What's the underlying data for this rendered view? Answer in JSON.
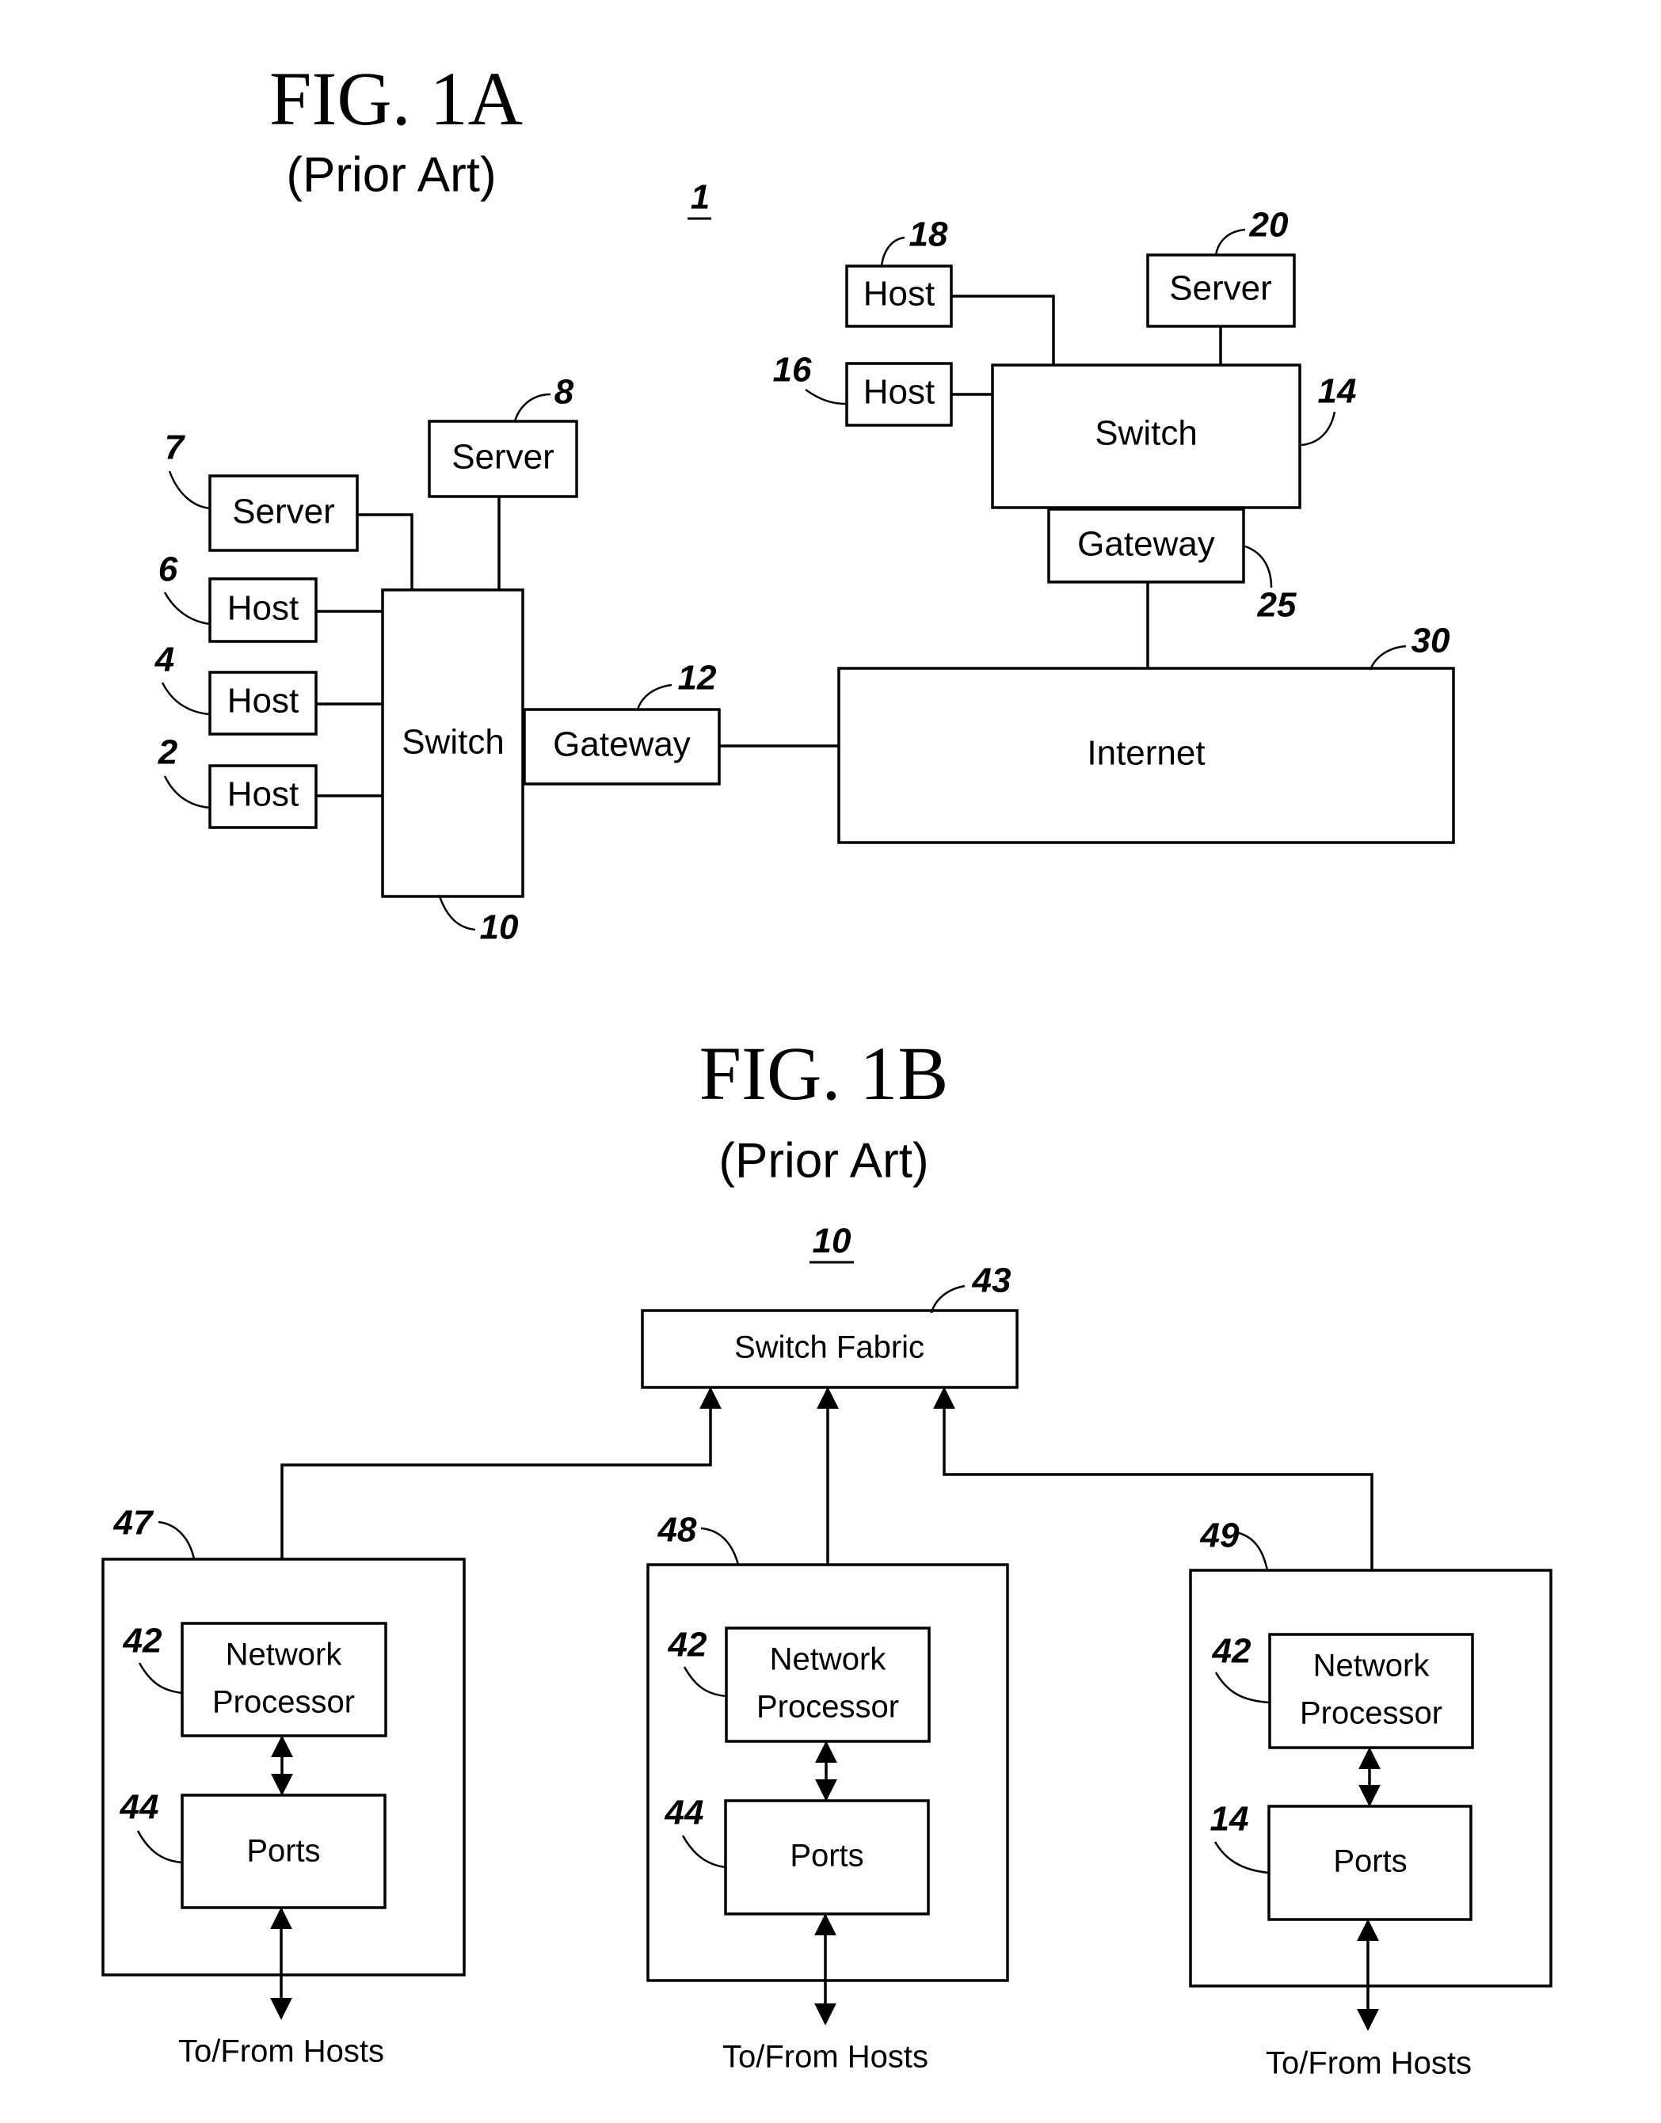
{
  "fig1a": {
    "title": "FIG. 1A",
    "subtitle": "(Prior Art)",
    "system_ref": "1",
    "nodes": {
      "server7": {
        "label": "Server",
        "ref": "7"
      },
      "server8": {
        "label": "Server",
        "ref": "8"
      },
      "host6": {
        "label": "Host",
        "ref": "6"
      },
      "host4": {
        "label": "Host",
        "ref": "4"
      },
      "host2": {
        "label": "Host",
        "ref": "2"
      },
      "switch10": {
        "label": "Switch",
        "ref": "10"
      },
      "gateway12": {
        "label": "Gateway",
        "ref": "12"
      },
      "internet30": {
        "label": "Internet",
        "ref": "30"
      },
      "gateway25": {
        "label": "Gateway",
        "ref": "25"
      },
      "switch14": {
        "label": "Switch",
        "ref": "14"
      },
      "host16": {
        "label": "Host",
        "ref": "16"
      },
      "host18": {
        "label": "Host",
        "ref": "18"
      },
      "server20": {
        "label": "Server",
        "ref": "20"
      }
    },
    "edges": [
      [
        "server7",
        "switch10"
      ],
      [
        "server8",
        "switch10"
      ],
      [
        "host6",
        "switch10"
      ],
      [
        "host4",
        "switch10"
      ],
      [
        "host2",
        "switch10"
      ],
      [
        "switch10",
        "gateway12"
      ],
      [
        "gateway12",
        "internet30"
      ],
      [
        "internet30",
        "gateway25"
      ],
      [
        "gateway25",
        "switch14"
      ],
      [
        "host16",
        "switch14"
      ],
      [
        "host18",
        "switch14"
      ],
      [
        "server20",
        "switch14"
      ]
    ]
  },
  "fig1b": {
    "title": "FIG. 1B",
    "subtitle": "(Prior Art)",
    "system_ref": "10",
    "switch_fabric": {
      "label": "Switch Fabric",
      "ref": "43"
    },
    "blades": [
      {
        "ref": "47",
        "np_label_1": "Network",
        "np_label_2": "Processor",
        "np_ref": "42",
        "ports_label": "Ports",
        "ports_ref": "44",
        "io_label": "To/From Hosts"
      },
      {
        "ref": "48",
        "np_label_1": "Network",
        "np_label_2": "Processor",
        "np_ref": "42",
        "ports_label": "Ports",
        "ports_ref": "44",
        "io_label": "To/From Hosts"
      },
      {
        "ref": "49",
        "np_label_1": "Network",
        "np_label_2": "Processor",
        "np_ref": "42",
        "ports_label": "Ports",
        "ports_ref": "14",
        "io_label": "To/From Hosts"
      }
    ],
    "edges": [
      [
        "switch_fabric",
        "blade47.np",
        "bidirectional"
      ],
      [
        "switch_fabric",
        "blade48.np",
        "bidirectional"
      ],
      [
        "switch_fabric",
        "blade49.np",
        "bidirectional"
      ],
      [
        "np",
        "ports",
        "bidirectional"
      ],
      [
        "ports",
        "hosts",
        "bidirectional"
      ]
    ]
  }
}
